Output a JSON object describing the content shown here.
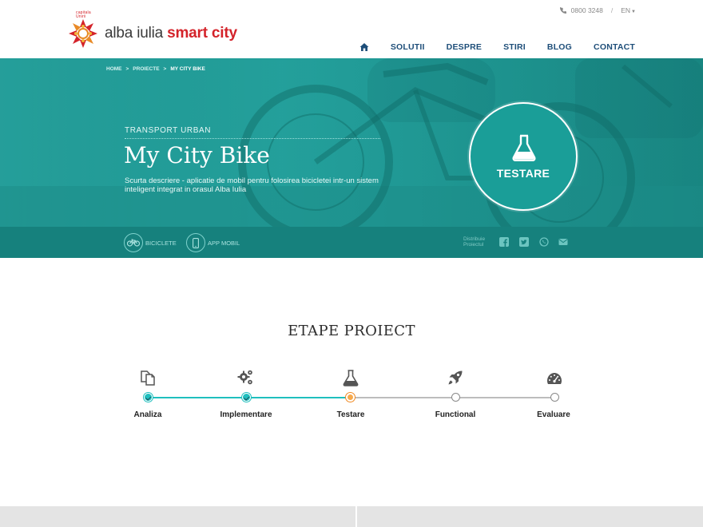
{
  "header": {
    "logo": {
      "tagline": "capitala Unirii",
      "text_plain": "alba iulia",
      "text_accent": "smart city"
    },
    "topbar": {
      "phone": "0800 3248",
      "separator": "/",
      "language": "EN"
    },
    "nav": {
      "items": [
        {
          "label": "SOLUTII"
        },
        {
          "label": "DESPRE"
        },
        {
          "label": "STIRI"
        },
        {
          "label": "BLOG"
        },
        {
          "label": "CONTACT"
        }
      ]
    }
  },
  "hero": {
    "breadcrumb": [
      "HOME",
      "PROIECTE",
      "MY CITY BIKE"
    ],
    "breadcrumb_sep": ">",
    "category": "TRANSPORT URBAN",
    "title": "My City Bike",
    "description": "Scurta descriere - aplicatie de mobil pentru folosirea bicicletei intr-un sistem inteligent integrat in orasul Alba Iulia",
    "status": "TESTARE"
  },
  "tagbar": {
    "tags": [
      {
        "label": "BICICLETE",
        "icon": "bicycle-icon"
      },
      {
        "label": "APP MOBIL",
        "icon": "mobile-phone-icon"
      }
    ],
    "share_label_line1": "Distribuie",
    "share_label_line2": "Proiectul",
    "social": [
      "facebook-icon",
      "twitter-icon",
      "whatsapp-icon",
      "email-icon"
    ]
  },
  "stages": {
    "title": "ETAPE PROIECT",
    "items": [
      {
        "label": "Analiza",
        "icon": "documents-icon",
        "state": "done"
      },
      {
        "label": "Implementare",
        "icon": "gears-icon",
        "state": "done"
      },
      {
        "label": "Testare",
        "icon": "flask-icon",
        "state": "current"
      },
      {
        "label": "Functional",
        "icon": "rocket-icon",
        "state": "pending"
      },
      {
        "label": "Evaluare",
        "icon": "dashboard-icon",
        "state": "pending"
      }
    ]
  },
  "colors": {
    "teal": "#1d9a95",
    "teal_dark": "#16817d",
    "nav_blue": "#1e4e79",
    "brand_red": "#d4232a",
    "progress_done": "#1fbfbe",
    "progress_current": "#f08a23",
    "progress_pending": "#bdbdbd"
  }
}
